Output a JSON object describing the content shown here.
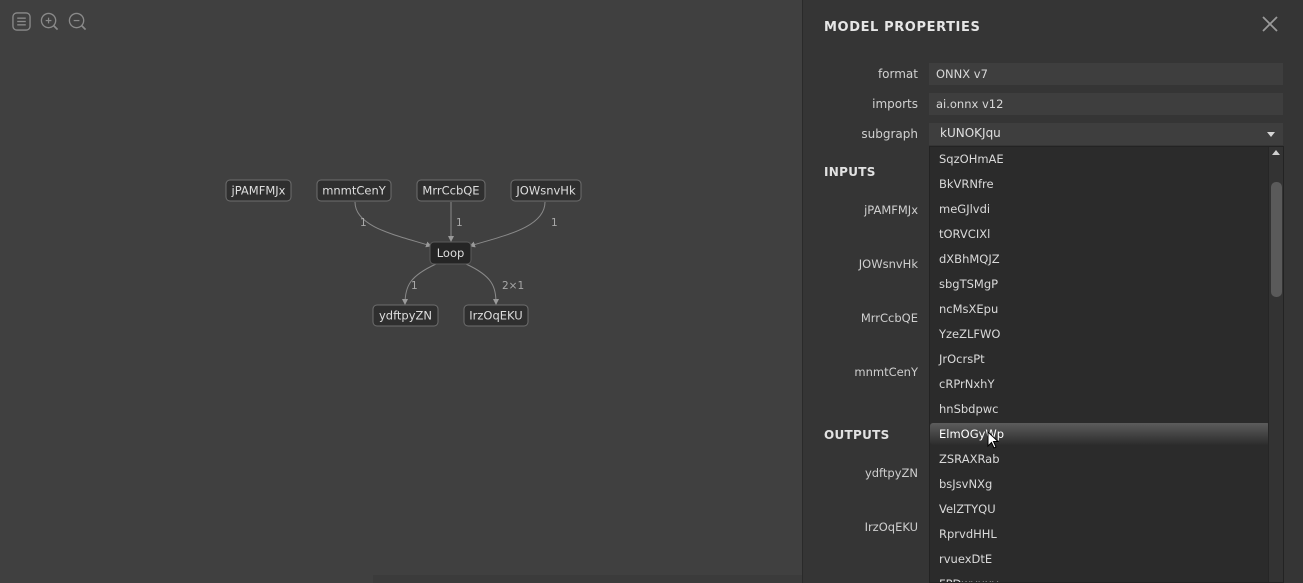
{
  "toolbar": {
    "items": [
      "sidebar-icon",
      "zoom-in-icon",
      "zoom-out-icon"
    ]
  },
  "graph": {
    "nodes": {
      "in1": "jPAMFMJx",
      "in2": "mnmtCenY",
      "in3": "MrrCcbQE",
      "in4": "JOWsnvHk",
      "loop": "Loop",
      "out1": "ydftpyZN",
      "out2": "IrzOqEKU"
    },
    "edge_labels": {
      "e_in2": "1",
      "e_in3": "1",
      "e_in4": "1",
      "e_out1": "1",
      "e_out2": "2×1"
    }
  },
  "sidebar": {
    "title": "MODEL PROPERTIES",
    "close_icon": "close-icon",
    "properties": {
      "format_label": "format",
      "format_value": "ONNX v7",
      "imports_label": "imports",
      "imports_value": "ai.onnx v12",
      "subgraph_label": "subgraph",
      "subgraph_value": "kUNOKJqu"
    },
    "inputs_header": "INPUTS",
    "inputs": [
      "jPAMFMJx",
      "JOWsnvHk",
      "MrrCcbQE",
      "mnmtCenY"
    ],
    "outputs_header": "OUTPUTS",
    "outputs": [
      "ydftpyZN",
      "IrzOqEKU"
    ],
    "dropdown_options": [
      "SqzOHmAE",
      "BkVRNfre",
      "meGJlvdi",
      "tORVCIXl",
      "dXBhMQJZ",
      "sbgTSMgP",
      "ncMsXEpu",
      "YzeZLFWO",
      "JrOcrsPt",
      "cRPrNxhY",
      "hnSbdpwc",
      "ElmOGyWp",
      "ZSRAXRab",
      "bsJsvNXg",
      "VelZTYQU",
      "RprvdHHL",
      "rvuexDtE",
      "FPDwyuxy"
    ],
    "dropdown_highlighted": "ElmOGyWp"
  },
  "colors": {
    "canvas": "#404040",
    "node_fill": "#2f2f2f",
    "node_stroke": "#6e6e6e",
    "edge": "#8a8a8a",
    "sidebar": "#353535"
  }
}
